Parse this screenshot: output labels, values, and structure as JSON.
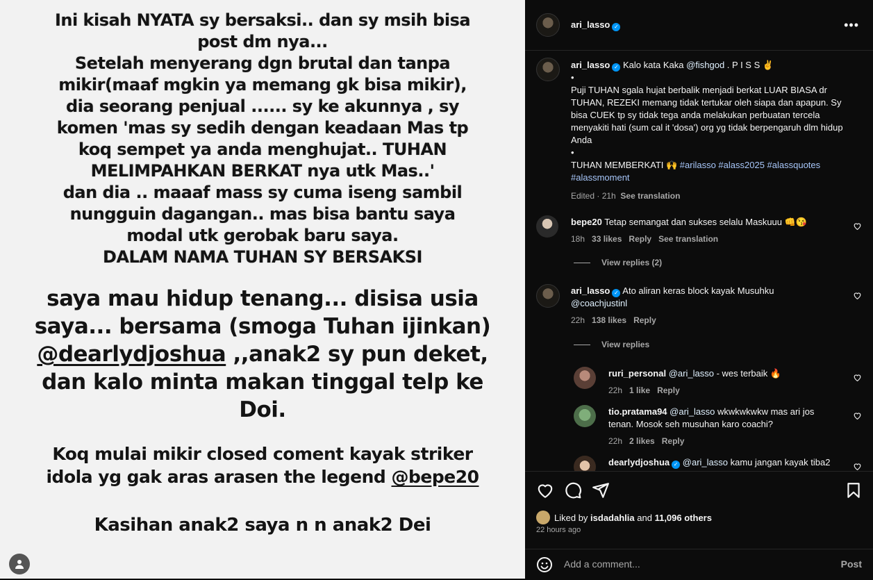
{
  "story": {
    "block1": [
      "Ini kisah NYATA sy bersaksi.. dan sy msih bisa",
      "post dm nya...",
      "Setelah menyerang dgn brutal dan tanpa",
      "mikir(maaf mgkin ya memang gk bisa mikir),",
      "dia seorang penjual ...... sy ke akunnya , sy",
      "komen 'mas sy sedih dengan keadaan Mas tp",
      "koq sempet ya anda menghujat.. TUHAN",
      "MELIMPAHKAN BERKAT nya utk Mas..'",
      "dan dia .. maaaf mass sy cuma iseng sambil",
      "nungguin dagangan.. mas bisa bantu saya",
      "modal utk gerobak baru saya.",
      "DALAM NAMA TUHAN SY BERSAKSI"
    ],
    "block2_line1": "saya mau hidup tenang... disisa usia",
    "block2_line2": "saya... bersama (smoga Tuhan ijinkan)",
    "block2_tag": "@dearlydjoshua",
    "block2_line3_rest": " ,,anak2 sy pun deket,",
    "block2_line4": "dan kalo minta makan tinggal telp ke",
    "block2_line5": "Doi.",
    "block3_line1": "Koq  mulai mikir closed coment kayak striker",
    "block3_line2_pre": "idola  yg gak aras arasen the legend ",
    "block3_tag": "@bepe20",
    "block4": "Kasihan anak2 saya n n anak2 Dei"
  },
  "header": {
    "username": "ari_lasso",
    "more": "•••"
  },
  "caption": {
    "username": "ari_lasso",
    "text_pre": "Kalo kata Kaka ",
    "mention": "@fishgod",
    "text_post": " . P I S S ✌",
    "bullet1": "•",
    "para": "Puji TUHAN sgala hujat berbalik menjadi berkat LUAR BIASA dr TUHAN, REZEKI memang tidak tertukar oleh siapa dan apapun. Sy bisa CUEK tp sy tidak tega anda melakukan perbuatan tercela menyakiti hati (sum cal it 'dosa') org yg tidak berpengaruh dlm hidup Anda",
    "bullet2": "•",
    "closing": "TUHAN MEMBERKATI 🙌 ",
    "hashtags": "#arilasso #alass2025 #alassquotes #alassmoment",
    "edited": "Edited · 21h",
    "see_translation": "See translation"
  },
  "comments": [
    {
      "user": "bepe20",
      "text": "Tetap semangat dan sukses selalu Maskuuu 👊😘",
      "time": "18h",
      "likes": "33 likes",
      "reply": "Reply",
      "translate": "See translation",
      "view_replies": "View replies (2)"
    },
    {
      "user": "ari_lasso",
      "text": "Ato aliran keras block kayak Musuhku ",
      "mention": "@coachjustinl",
      "time": "22h",
      "likes": "138 likes",
      "reply": "Reply",
      "view_replies": "View replies"
    },
    {
      "user": "ruri_personal",
      "mention": "@ari_lasso",
      "text": " - wes terbaik 🔥",
      "time": "22h",
      "likes": "1 like",
      "reply": "Reply"
    },
    {
      "user": "tio.pratama94",
      "mention": "@ari_lasso",
      "text": " wkwkwkwkw mas ari jos tenan. Mosok seh musuhan karo coachi?",
      "time": "22h",
      "likes": "2 likes",
      "reply": "Reply"
    },
    {
      "user": "dearlydjoshua",
      "mention": "@ari_lasso",
      "text": " kamu jangan kayak tiba2"
    }
  ],
  "footer": {
    "liked_by_pre": "Liked by ",
    "liked_by_user": "isdadahlia",
    "liked_by_mid": " and ",
    "liked_by_count": "11,096 others",
    "time_ago": "22 hours ago",
    "add_comment_placeholder": "Add a comment...",
    "post_label": "Post"
  },
  "colors": {
    "verified": "#0095f6",
    "link": "#e0f1ff",
    "hashtag": "#a8c7fa"
  }
}
